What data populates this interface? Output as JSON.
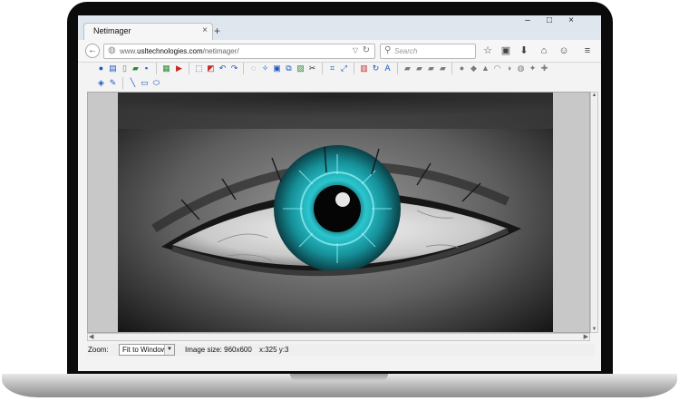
{
  "browser": {
    "tab_title": "Netimager",
    "tab_close": "×",
    "new_tab": "+",
    "window_controls": [
      "–",
      "□",
      "×"
    ],
    "url_prefix": "www.",
    "url_domain": "usltechnologies.com",
    "url_path": "/netimager/",
    "search_placeholder": "Search",
    "back_glyph": "←",
    "nav_icons": [
      "☆",
      "▣",
      "⬇",
      "⌂",
      "☺",
      "≡"
    ]
  },
  "status": {
    "zoom_label": "Zoom:",
    "zoom_value": "Fit to Window",
    "image_size": "Image size: 960x600",
    "coordinates": "x:325 y:3"
  },
  "colors": {
    "iris": "#1aa3ad",
    "accent": "#1a56c9"
  }
}
